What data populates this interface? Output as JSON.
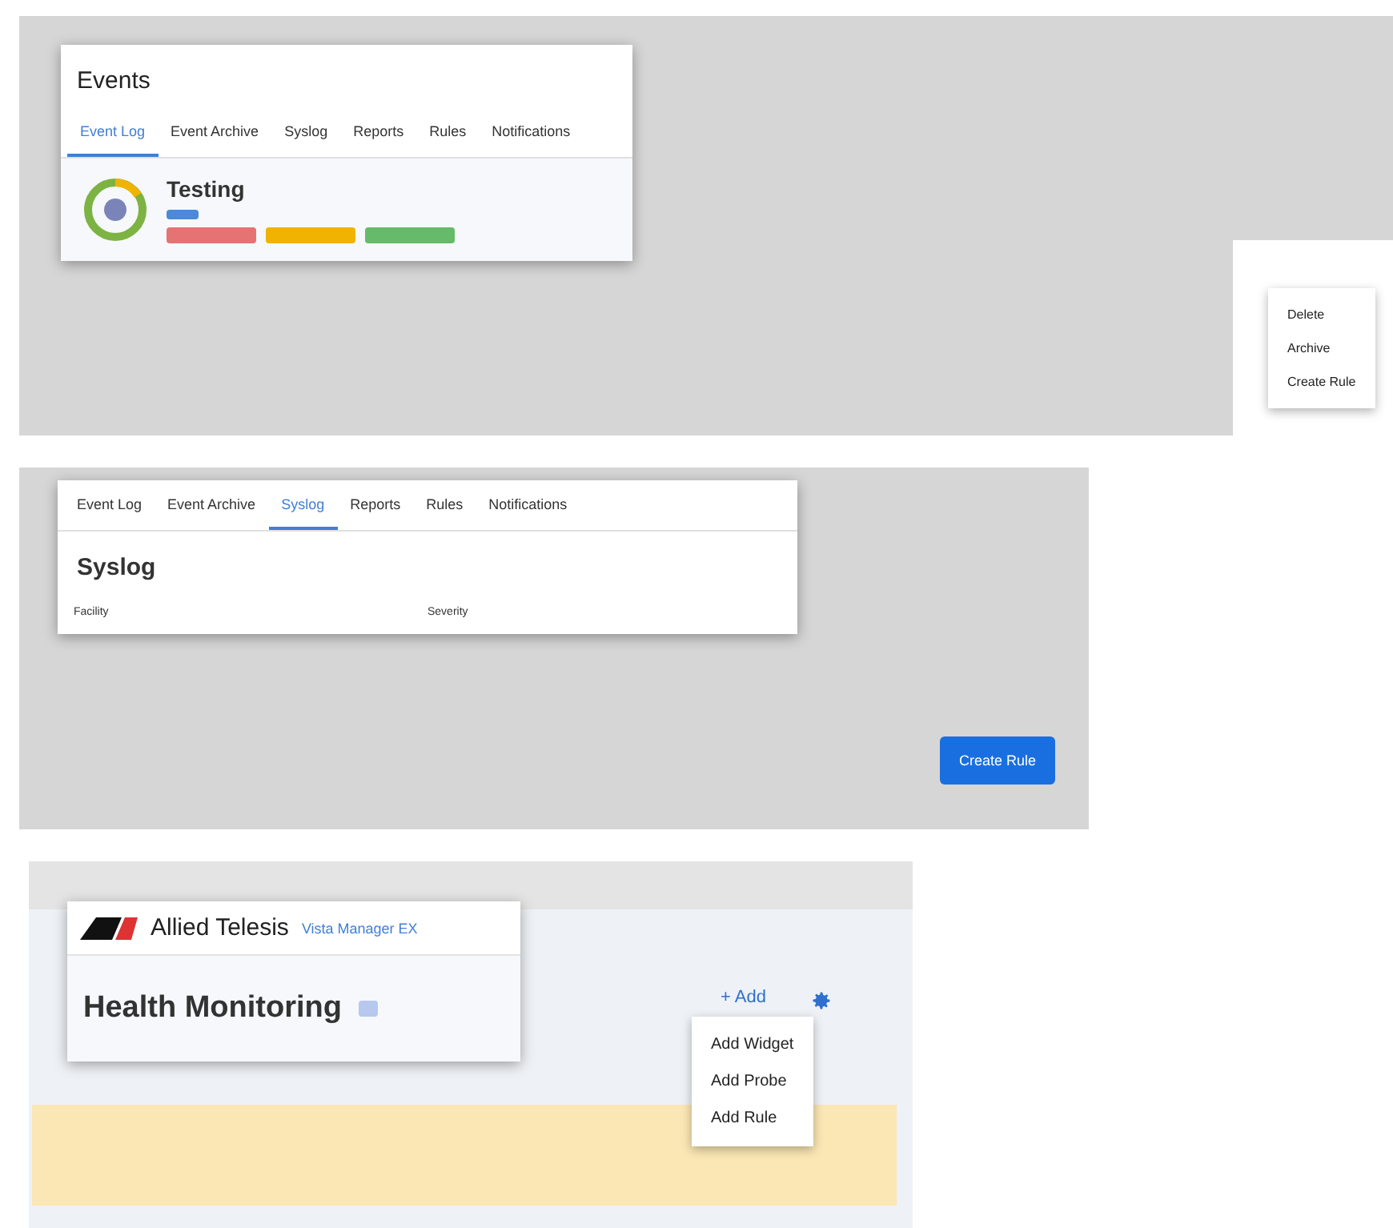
{
  "events_panel": {
    "title": "Events",
    "tabs": [
      {
        "label": "Event Log",
        "selected": true
      },
      {
        "label": "Event Archive",
        "selected": false
      },
      {
        "label": "Syslog",
        "selected": false
      },
      {
        "label": "Reports",
        "selected": false
      },
      {
        "label": "Rules",
        "selected": false
      },
      {
        "label": "Notifications",
        "selected": false
      }
    ],
    "device": {
      "name": "Testing",
      "tags": [
        {
          "color": "#e57373"
        },
        {
          "color": "#f0b400"
        },
        {
          "color": "#66bb6a"
        }
      ]
    },
    "menu": [
      {
        "label": "Delete"
      },
      {
        "label": "Archive"
      },
      {
        "label": "Create Rule"
      }
    ]
  },
  "syslog_panel": {
    "tabs": [
      {
        "label": "Event Log",
        "selected": false
      },
      {
        "label": "Event Archive",
        "selected": false
      },
      {
        "label": "Syslog",
        "selected": true
      },
      {
        "label": "Reports",
        "selected": false
      },
      {
        "label": "Rules",
        "selected": false
      },
      {
        "label": "Notifications",
        "selected": false
      }
    ],
    "title": "Syslog",
    "columns": [
      "Facility",
      "Severity"
    ],
    "button": "Create Rule"
  },
  "health_panel": {
    "brand": "Allied Telesis",
    "product": "Vista Manager EX",
    "title": "Health Monitoring",
    "add": "+ Add",
    "menu": [
      {
        "label": "Add Widget"
      },
      {
        "label": "Add Probe"
      },
      {
        "label": "Add Rule"
      }
    ]
  }
}
